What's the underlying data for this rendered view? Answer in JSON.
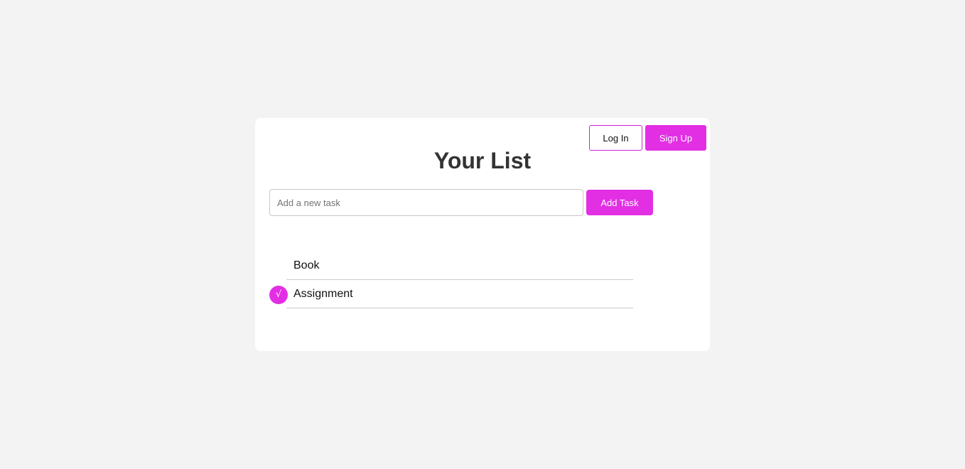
{
  "header": {
    "login_label": "Log In",
    "signup_label": "Sign Up"
  },
  "page": {
    "title": "Your List"
  },
  "task_form": {
    "input_value": "",
    "placeholder": "Add a new task",
    "add_label": "Add Task"
  },
  "tasks": [
    {
      "label": "Book",
      "checked": false
    },
    {
      "label": "Assignment",
      "checked": true,
      "check_glyph": "√"
    }
  ],
  "colors": {
    "accent": "#e22fe4",
    "background": "#f3f3f3",
    "card": "#ffffff"
  }
}
